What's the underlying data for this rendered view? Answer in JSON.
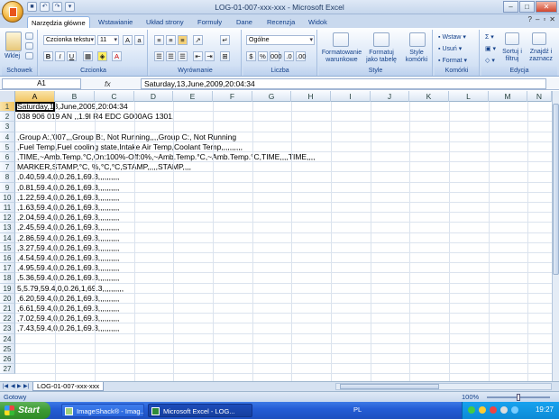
{
  "window": {
    "title": "LOG-01-007-xxx-xxx - Microsoft Excel"
  },
  "ribbon_tabs": [
    "Narzędzia główne",
    "Wstawianie",
    "Układ strony",
    "Formuły",
    "Dane",
    "Recenzja",
    "Widok"
  ],
  "ribbon": {
    "clipboard": {
      "label": "Schowek",
      "paste": "Wklej"
    },
    "font": {
      "label": "Czcionka",
      "font_name": "Czcionka tekstu",
      "font_size": "11"
    },
    "alignment": {
      "label": "Wyrównanie"
    },
    "number": {
      "label": "Liczba",
      "format": "Ogólne"
    },
    "styles": {
      "label": "Style",
      "cond": "Formatowanie warunkowe",
      "table": "Formatuj jako tabelę",
      "cell": "Style komórki"
    },
    "cells": {
      "label": "Komórki",
      "insert": "Wstaw",
      "delete": "Usuń",
      "format": "Format"
    },
    "editing": {
      "label": "Edycja",
      "sort": "Sortuj i filtruj",
      "find": "Znajdź i zaznacz"
    }
  },
  "formula_bar": {
    "name_box": "A1",
    "fx": "fx",
    "content": "Saturday,13,June,2009,20:04:34"
  },
  "columns": [
    "A",
    "B",
    "C",
    "D",
    "E",
    "F",
    "G",
    "H",
    "I",
    "J",
    "K",
    "L",
    "M",
    "N"
  ],
  "rows": [
    {
      "n": "1",
      "text": "Saturday,13,June,2009,20:04:34"
    },
    {
      "n": "2",
      "text": "038 906 019 AN ,,1.9l R4 EDC G000AG  1301,"
    },
    {
      "n": "3",
      "text": ""
    },
    {
      "n": "4",
      "text": ",Group A:,'007,,,Group B:, Not Running,,,,Group C:, Not Running"
    },
    {
      "n": "5",
      "text": ",Fuel Temp,Fuel cooling state,Intake Air Temp,Coolant Temp,,,,,,,,,,"
    },
    {
      "n": "6",
      "text": ",TIME,~Amb.Temp.°C,On:100%-Off:0%,~Amb.Temp.°C,~Amb.Temp.°C,TIME,,,,TIME,,,,"
    },
    {
      "n": "7",
      "text": "MARKER,STAMP,°C, %,°C,°C,STAMP,,,,,STAMP,,,,"
    },
    {
      "n": "8",
      "text": ",0.40,59.4,0,0.26,1,69.3,,,,,,,,,,"
    },
    {
      "n": "9",
      "text": ",0.81,59.4,0,0.26,1,69.3,,,,,,,,,,"
    },
    {
      "n": "10",
      "text": ",1.22,59.4,0,0.26,1,69.3,,,,,,,,,,"
    },
    {
      "n": "11",
      "text": ",1.63,59.4,0,0.26,1,69.3,,,,,,,,,,"
    },
    {
      "n": "12",
      "text": ",2.04,59.4,0,0.26,1,69.3,,,,,,,,,,"
    },
    {
      "n": "13",
      "text": ",2.45,59.4,0,0.26,1,69.3,,,,,,,,,,"
    },
    {
      "n": "14",
      "text": ",2.86,59.4,0,0.26,1,69.3,,,,,,,,,,"
    },
    {
      "n": "15",
      "text": ",3.27,59.4,0,0.26,1,69.3,,,,,,,,,,"
    },
    {
      "n": "16",
      "text": ",4.54,59.4,0,0.26,1,69.3,,,,,,,,,,"
    },
    {
      "n": "17",
      "text": ",4.95,59.4,0,0.26,1,69.3,,,,,,,,,,"
    },
    {
      "n": "18",
      "text": ",5.36,59.4,0,0.26,1,69.3,,,,,,,,,,"
    },
    {
      "n": "19",
      "text": "5,5.79,59.4,0,0.26,1,69.3,,,,,,,,,,"
    },
    {
      "n": "20",
      "text": ",6.20,59.4,0,0.26,1,69.3,,,,,,,,,,"
    },
    {
      "n": "21",
      "text": ",6.61,59.4,0,0.26,1,69.3,,,,,,,,,,"
    },
    {
      "n": "22",
      "text": ",7.02,59.4,0,0.26,1,69.3,,,,,,,,,,"
    },
    {
      "n": "23",
      "text": ",7.43,59.4,0,0.26,1,69.3,,,,,,,,,,"
    },
    {
      "n": "24",
      "text": ""
    },
    {
      "n": "25",
      "text": ""
    },
    {
      "n": "26",
      "text": ""
    },
    {
      "n": "27",
      "text": ""
    }
  ],
  "sheet_tab": "LOG-01-007-xxx-xxx",
  "status": {
    "ready": "Gotowy",
    "zoom": "100%"
  },
  "taskbar": {
    "start": "Start",
    "tasks": [
      "ImageShack® - Imag...",
      "Microsoft Excel - LOG..."
    ],
    "lang": "PL",
    "clock": "19:27"
  }
}
